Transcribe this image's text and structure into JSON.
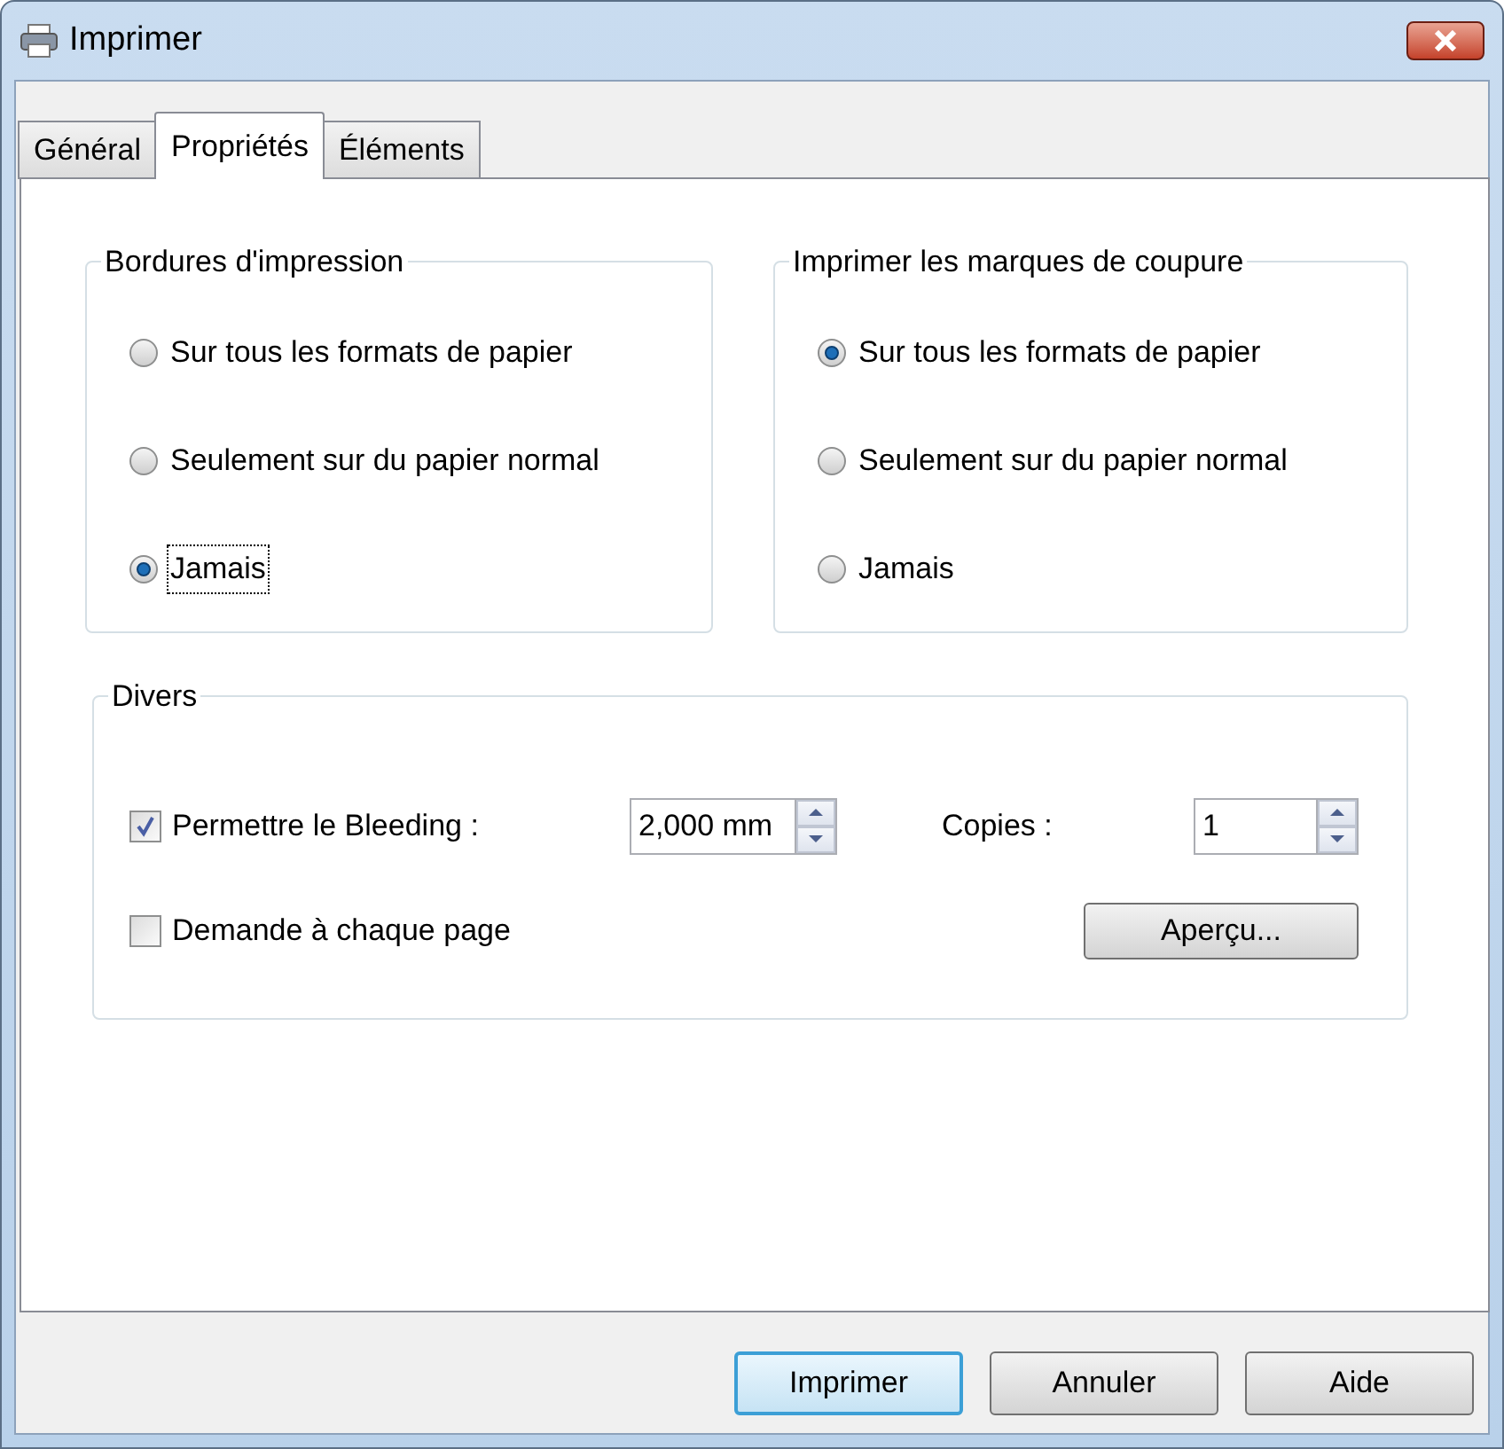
{
  "window": {
    "title": "Imprimer"
  },
  "tabs": [
    {
      "label": "Général",
      "selected": false
    },
    {
      "label": "Propriétés",
      "selected": true
    },
    {
      "label": "Éléments",
      "selected": false
    }
  ],
  "groups": [
    {
      "title": "Bordures d'impression",
      "options": [
        {
          "label": "Sur tous les formats de papier",
          "selected": false,
          "focused": false
        },
        {
          "label": "Seulement sur du papier normal",
          "selected": false,
          "focused": false
        },
        {
          "label": "Jamais",
          "selected": true,
          "focused": true
        }
      ]
    },
    {
      "title": "Imprimer les marques de coupure",
      "options": [
        {
          "label": "Sur tous les formats de papier",
          "selected": true,
          "focused": false
        },
        {
          "label": "Seulement sur du papier normal",
          "selected": false,
          "focused": false
        },
        {
          "label": "Jamais",
          "selected": false,
          "focused": false
        }
      ]
    }
  ],
  "misc": {
    "title": "Divers",
    "bleeding": {
      "label": "Permettre le Bleeding :",
      "checked": true,
      "value": "2,000 mm"
    },
    "copies": {
      "label": "Copies :",
      "value": "1"
    },
    "ask_each_page": {
      "label": "Demande à chaque page",
      "checked": false
    },
    "preview_button": "Aperçu..."
  },
  "buttons": [
    {
      "label": "Imprimer",
      "default": true
    },
    {
      "label": "Annuler",
      "default": false
    },
    {
      "label": "Aide",
      "default": false
    }
  ]
}
